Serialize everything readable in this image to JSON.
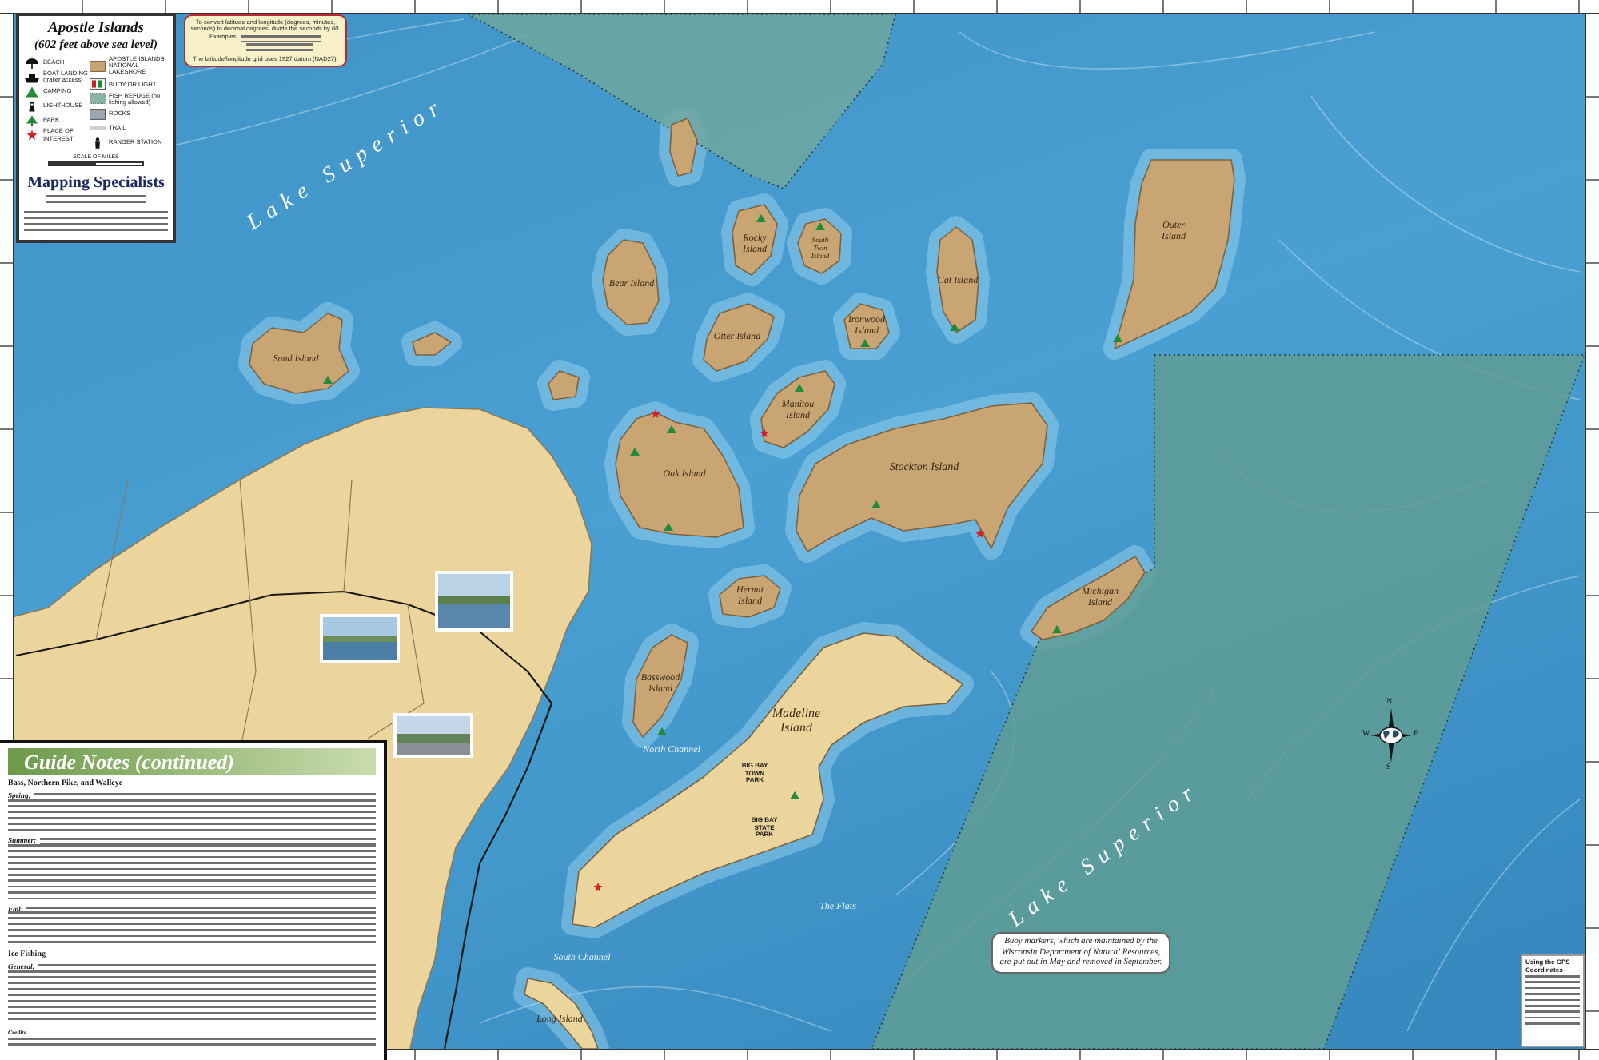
{
  "legend": {
    "title": "Apostle Islands",
    "subtitle": "(602 feet above sea level)",
    "columns": [
      [
        {
          "kind": "beach",
          "label": "BEACH"
        },
        {
          "kind": "boat_landing",
          "label": "BOAT LANDING (trailer access)"
        },
        {
          "kind": "camping",
          "label": "CAMPING"
        },
        {
          "kind": "lighthouse",
          "label": "LIGHTHOUSE"
        },
        {
          "kind": "park",
          "label": "PARK"
        },
        {
          "kind": "place_of_interest",
          "label": "PLACE OF INTEREST"
        }
      ],
      [
        {
          "kind": "lakeshore",
          "label": "APOSTLE ISLANDS NATIONAL LAKESHORE"
        },
        {
          "kind": "buoy",
          "label": "BUOY OR LIGHT"
        },
        {
          "kind": "fish_refuge",
          "label": "FISH REFUGE (no fishing allowed)"
        },
        {
          "kind": "rocks",
          "label": "ROCKS"
        },
        {
          "kind": "trail",
          "label": "TRAIL"
        },
        {
          "kind": "ranger_station",
          "label": "RANGER STATION"
        }
      ]
    ],
    "scale": {
      "label": "SCALE OF MILES"
    },
    "publisher": "Mapping Specialists"
  },
  "coordinate_note": {
    "text": "To convert latitude and longitude (degrees, minutes, seconds) to decimal degrees, divide the seconds by 60.",
    "examples_label": "Examples:",
    "datum": "The latitude/longitude grid uses 1927 datum (NAD27)."
  },
  "map": {
    "islands": [
      {
        "name": "Rocky Island"
      },
      {
        "name": "South Twin Island"
      },
      {
        "name": "Outer Island"
      },
      {
        "name": "Bear Island"
      },
      {
        "name": "Cat Island"
      },
      {
        "name": "Otter Island"
      },
      {
        "name": "Ironwood Island"
      },
      {
        "name": "Sand Island"
      },
      {
        "name": "Manitou Island"
      },
      {
        "name": "Oak Island"
      },
      {
        "name": "Stockton Island"
      },
      {
        "name": "Hermit Island"
      },
      {
        "name": "Michigan Island"
      },
      {
        "name": "Basswood Island"
      },
      {
        "name": "Madeline Island"
      },
      {
        "name": "Long Island"
      }
    ],
    "water_labels": [
      {
        "kind": "lake",
        "text": "Lake Superior"
      },
      {
        "kind": "lake",
        "text": "Lake Superior"
      },
      {
        "kind": "area",
        "text": "North Channel"
      },
      {
        "kind": "area",
        "text": "The Flats"
      },
      {
        "kind": "area",
        "text": "South Channel"
      }
    ],
    "parks": [
      {
        "label": "BIG BAY TOWN PARK"
      },
      {
        "label": "BIG BAY STATE PARK"
      }
    ],
    "note": "Buoy markers, which are maintained by the Wisconsin Department of Natural Resources, are put out in May and removed in September.",
    "compass": {
      "north": "N",
      "south": "S",
      "east": "E",
      "west": "W"
    },
    "gps_box": {
      "title": "Using the GPS Coordinates"
    }
  },
  "guide_notes": {
    "title": "Guide Notes (continued)",
    "sections": [
      {
        "heading": "Bass, Northern Pike, and Walleye",
        "paragraphs": [
          {
            "lead": "Spring:"
          },
          {
            "lead": "Summer:"
          },
          {
            "lead": "Fall:"
          }
        ]
      },
      {
        "heading": "Ice Fishing",
        "paragraphs": [
          {
            "lead": "General:"
          }
        ]
      }
    ],
    "credits": "Credits"
  }
}
